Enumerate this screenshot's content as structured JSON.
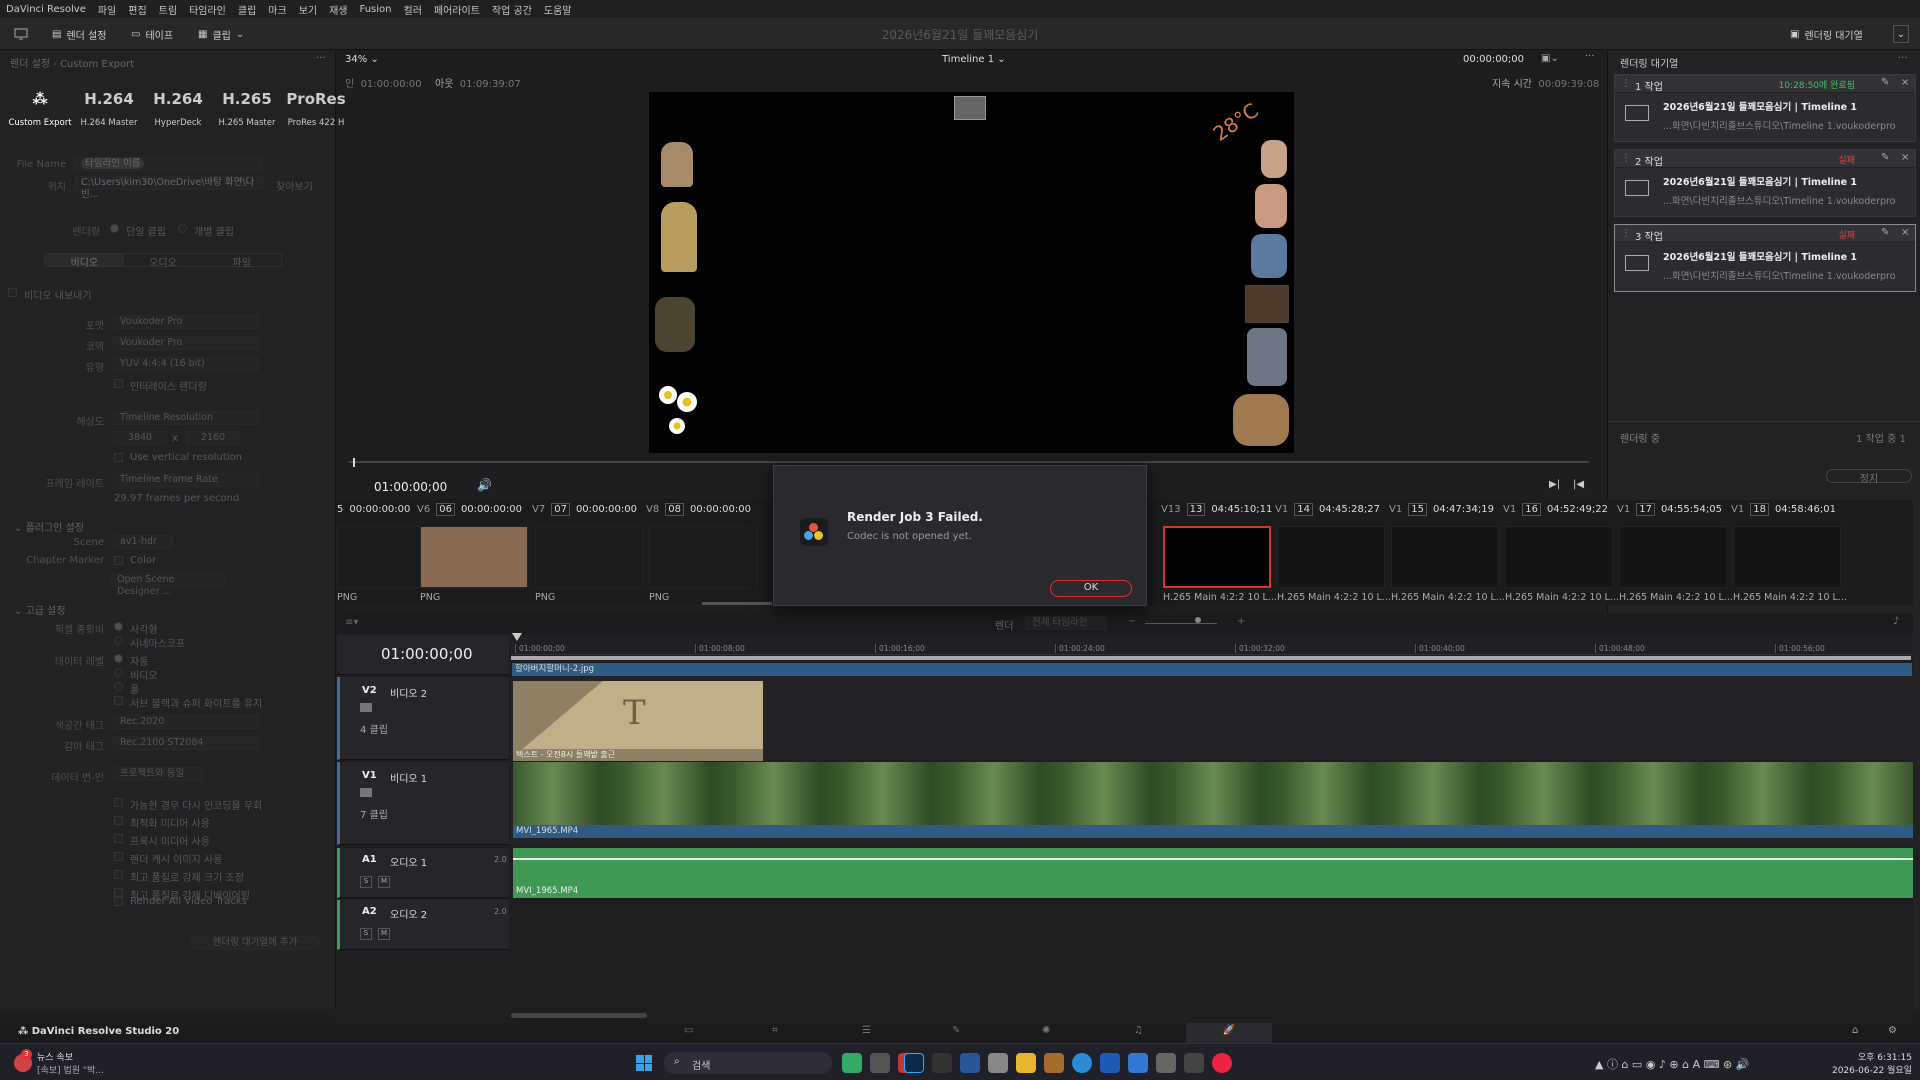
{
  "menu": [
    "DaVinci Resolve",
    "파일",
    "편집",
    "트림",
    "타임라인",
    "클립",
    "마크",
    "보기",
    "재생",
    "Fusion",
    "컬러",
    "페어라이트",
    "작업 공간",
    "도움말"
  ],
  "toolbar": {
    "render_settings": "렌더 설정",
    "tape": "테이프",
    "clip": "클립",
    "project_title": "2026년6월21일 들꽤모음심기",
    "render_queue": "렌더링 대기열"
  },
  "render": {
    "header": "렌더 설정 - Custom Export",
    "presets": [
      {
        "big": "",
        "small": "Custom Export"
      },
      {
        "big": "H.264",
        "small": "H.264 Master"
      },
      {
        "big": "H.264",
        "small": "HyperDeck"
      },
      {
        "big": "H.265",
        "small": "H.265 Master"
      },
      {
        "big": "ProRes",
        "small": "ProRes 422 H"
      }
    ],
    "file_name_label": "File Name",
    "file_name_value": "타임라인 이름",
    "location_label": "위치",
    "location_value": "C:\\Users\\kim30\\OneDrive\\바탕 화면\\다빈...",
    "browse": "찾아보기",
    "render_label": "렌더링",
    "single_clip": "단일 클립",
    "individual_clips": "개별 클립",
    "tabs": [
      "비디오",
      "오디오",
      "파일"
    ],
    "export_video": "비디오 내보내기",
    "format_label": "포맷",
    "format": "Voukoder Pro",
    "codec_label": "코덱",
    "codec": "Voukoder Pro",
    "type_label": "유형",
    "type": "YUV 4:4:4 (16 bit)",
    "interlace": "인터레이스 렌더링",
    "resolution_label": "해상도",
    "resolution": "Timeline Resolution",
    "width": "3840",
    "x": "x",
    "height": "2160",
    "vertical": "Use vertical resolution",
    "framerate_label": "프레임 레이트",
    "framerate": "Timeline Frame Rate",
    "fps": "29.97 frames per second",
    "plugin_header": "플러그인 설정",
    "scene_label": "Scene",
    "scene": "av1-hdr",
    "chapter_label": "Chapter Marker",
    "color_label": "Color",
    "scene_designer": "Open Scene Designer ...",
    "advanced_header": "고급 설정",
    "pixel_label": "픽셀 종횡비",
    "pixel_opts": [
      "사각형",
      "시네마스코프"
    ],
    "levels_label": "데이터 레벨",
    "level_opts": [
      "자동",
      "비디오",
      "풀"
    ],
    "flip_opt": "서브 블랙과 슈퍼 화이트를 유지",
    "color_tag_label": "색공간 태그",
    "color_tag": "Rec.2020",
    "gamma_tag_label": "감마 태그",
    "gamma_tag": "Rec.2100 ST2084",
    "burnin_label": "데이터 번-인",
    "burnin": "프로젝트와 동일",
    "checks": [
      "가능한 경우 다시 인코딩을 우회",
      "최적화 미디어 사용",
      "프록시 미디어 사용",
      "렌더 캐시 이미지 사용",
      "최고 품질로 강제 크기 조정",
      "최고 품질로 강제 디베이어링"
    ],
    "render_all": "Render All Video Tracks",
    "add_queue": "렌더링 대기열에 추가"
  },
  "viewer": {
    "zoom": "34%",
    "timeline_name": "Timeline 1",
    "tc_right": "00:00:00;00",
    "in_label": "인",
    "in_tc": "01:00:00:00",
    "out_label": "아웃",
    "out_tc": "01:09:39:07",
    "duration_label": "지속 시간",
    "duration": "00:09:39:08",
    "temp": "28°C",
    "current_tc": "01:00:00;00"
  },
  "queue": {
    "jobs": [
      {
        "title": "1 작업",
        "status": "10:28:50에 완료됨",
        "status_color": "#3fbf5f",
        "name": "2026년6월21일 들꽤모음심기  | Timeline 1",
        "path": "...화면\\다빈치리졸브스튜디오\\Timeline 1.voukoderpro"
      },
      {
        "title": "2 작업",
        "status": "실패",
        "status_color": "#e04040",
        "name": "2026년6월21일 들꽤모음심기  | Timeline 1",
        "path": "...화면\\다빈치리졸브스튜디오\\Timeline 1.voukoderpro"
      },
      {
        "title": "3 작업",
        "status": "실패",
        "status_color": "#e04040",
        "name": "2026년6월21일 들꽤모음심기  | Timeline 1",
        "path": "...화면\\다빈치리졸브스튜디오\\Timeline 1.voukoderpro"
      }
    ],
    "rendering_label": "렌더링 중",
    "count": "1 작업 중 1",
    "stop": "정지"
  },
  "clips": {
    "headers": [
      {
        "track": "V6",
        "num": "06",
        "tc": "00:00:00:00"
      },
      {
        "track": "V7",
        "num": "07",
        "tc": "00:00:00:00"
      },
      {
        "track": "V8",
        "num": "08",
        "tc": "00:00:00:00"
      },
      {
        "track": "V13",
        "num": "13",
        "tc": "04:45:10;11"
      },
      {
        "track": "V1",
        "num": "14",
        "tc": "04:45:28;27"
      },
      {
        "track": "V1",
        "num": "15",
        "tc": "04:47:34;19"
      },
      {
        "track": "V1",
        "num": "16",
        "tc": "04:52:49;22"
      },
      {
        "track": "V1",
        "num": "17",
        "tc": "04:55:54;05"
      },
      {
        "track": "V1",
        "num": "18",
        "tc": "04:58:46;01"
      }
    ],
    "first_tc": "00:00:00:00",
    "pre_label": "5",
    "last_tc": "00:00:00:00",
    "last_track": "V1",
    "labels": [
      "PNG",
      "PNG",
      "PNG",
      "PNG",
      "H.265 Main 4:2:2 10 L...",
      "H.265 Main 4:2:2 10 L...",
      "H.265 Main 4:2:2 10 L...",
      "H.265 Main 4:2:2 10 L...",
      "H.265 Main 4:2:2 10 L...",
      "H.265 Main 4:2:2 10 L..."
    ]
  },
  "dialog": {
    "title": "Render Job 3 Failed.",
    "message": "Codec is not opened yet.",
    "ok": "OK"
  },
  "timeline": {
    "render_label": "렌더",
    "render_sel": "전체 타임라인",
    "tc": "01:00:00;00",
    "ruler": [
      "01:00:00;00",
      "01:00:08;00",
      "01:00:16;00",
      "01:00:24;00",
      "01:00:32;00",
      "01:00:40;00",
      "01:00:48;00",
      "01:00:56;00"
    ],
    "top_clip": "할아버지할머니-2.jpg",
    "v2": {
      "id": "V2",
      "name": "비디오 2",
      "count": "4 클립",
      "clip": "텍스트 - 오전8시 들꽤밭 출근"
    },
    "v1": {
      "id": "V1",
      "name": "비디오 1",
      "count": "7 클립",
      "clip": "MVI_1965.MP4"
    },
    "a1": {
      "id": "A1",
      "name": "오디오 1",
      "ch": "2.0",
      "clip": "MVI_1965.MP4"
    },
    "a2": {
      "id": "A2",
      "name": "오디오 2",
      "ch": "2.0"
    },
    "s": "S",
    "m": "M"
  },
  "bottom": {
    "app": "DaVinci Resolve Studio 20"
  },
  "taskbar": {
    "news_title": "뉴스 속보",
    "news_sub": "[속보] 법원 \"박...",
    "badge": "3",
    "search": "검색",
    "time": "오후 6:31:15",
    "date": "2026-06-22 월요일"
  }
}
